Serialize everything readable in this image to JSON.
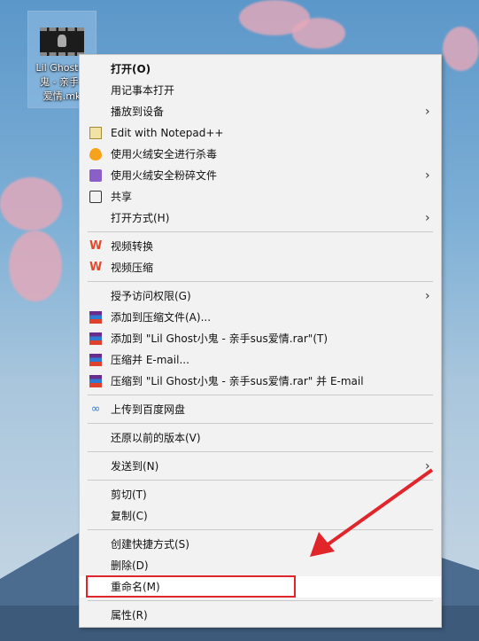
{
  "desktop": {
    "file_label": "Lil Ghost小\n鬼 - 亲手s\n爱情.mk"
  },
  "menu": {
    "items": [
      {
        "label": "打开(O)",
        "bold": true
      },
      {
        "label": "用记事本打开"
      },
      {
        "label": "播放到设备",
        "submenu": true
      },
      {
        "label": "Edit with Notepad++",
        "icon": "notepad-icon"
      },
      {
        "label": "使用火绒安全进行杀毒",
        "icon": "fire-icon"
      },
      {
        "label": "使用火绒安全粉碎文件",
        "icon": "shred-icon",
        "submenu": true
      },
      {
        "label": "共享",
        "icon": "share-icon"
      },
      {
        "label": "打开方式(H)",
        "submenu": true
      },
      {
        "label": "视频转换",
        "icon": "wps-video-icon"
      },
      {
        "label": "视频压缩",
        "icon": "wps-video-icon"
      },
      {
        "label": "授予访问权限(G)",
        "submenu": true
      },
      {
        "label": "添加到压缩文件(A)...",
        "icon": "winrar-icon"
      },
      {
        "label": "添加到 \"Lil Ghost小鬼 - 亲手sus爱情.rar\"(T)",
        "icon": "winrar-icon"
      },
      {
        "label": "压缩并 E-mail...",
        "icon": "winrar-icon"
      },
      {
        "label": "压缩到 \"Lil Ghost小鬼 - 亲手sus爱情.rar\" 并 E-mail",
        "icon": "winrar-icon"
      },
      {
        "label": "上传到百度网盘",
        "icon": "baidu-cloud-icon"
      },
      {
        "label": "还原以前的版本(V)"
      },
      {
        "label": "发送到(N)",
        "submenu": true
      },
      {
        "label": "剪切(T)"
      },
      {
        "label": "复制(C)"
      },
      {
        "label": "创建快捷方式(S)"
      },
      {
        "label": "删除(D)"
      },
      {
        "label": "重命名(M)",
        "highlighted": true
      },
      {
        "label": "属性(R)"
      }
    ],
    "submenu_arrow": "›"
  },
  "annotation": {
    "color": "#e0262b"
  }
}
